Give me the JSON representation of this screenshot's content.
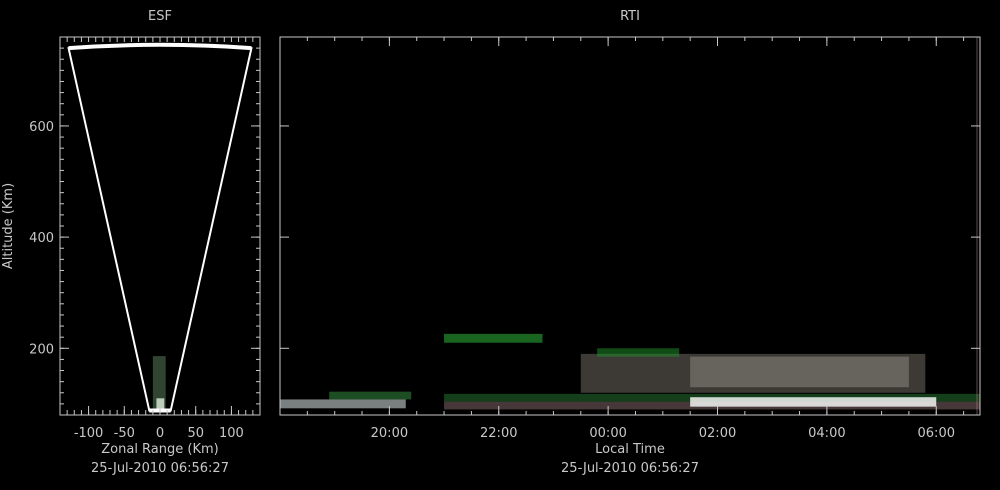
{
  "colors": {
    "background": "#000000",
    "frame": "#c8c8c8",
    "text": "#c8c8c8",
    "fan": "#ffffff",
    "echo_white": "#e8e8e8",
    "echo_green": "#2fb53a",
    "echo_pink": "#c98f8f"
  },
  "chart_data": [
    {
      "type": "esf-fan",
      "title": "ESF",
      "xlabel": "Zonal Range (Km)",
      "ylabel": "Altitude (Km)",
      "timestamp": "25-Jul-2010 06:56:27",
      "xlim": [
        -140,
        140
      ],
      "ylim": [
        80,
        760
      ],
      "xticks": [
        -100,
        -50,
        0,
        50,
        100
      ],
      "xtick_labels": [
        "-100",
        "-50",
        "0",
        "50",
        "100"
      ],
      "yticks": [
        200,
        400,
        600
      ],
      "ytick_labels": [
        "200",
        "400",
        "600"
      ],
      "fan": {
        "apex_altitude": 88,
        "apex_halfwidth": 15,
        "top_altitude": 740,
        "top_halfwidth": 128,
        "arc_peak_altitude": 746
      },
      "echoes": [
        {
          "x0": -10,
          "x1": 8,
          "y0": 88,
          "y1": 186,
          "color": "#5a7a5a",
          "opacity": 0.55
        },
        {
          "x0": -5,
          "x1": 6,
          "y0": 88,
          "y1": 110,
          "color": "#e0f0e0",
          "opacity": 0.8
        }
      ]
    },
    {
      "type": "heatmap",
      "title": "RTI",
      "xlabel": "Local Time",
      "ylabel": "",
      "timestamp": "25-Jul-2010 06:56:27",
      "x_unit": "hours since 18:00",
      "xlim": [
        0,
        12.8
      ],
      "ylim": [
        80,
        760
      ],
      "xticks": [
        2,
        4,
        6,
        8,
        10,
        12
      ],
      "xtick_labels": [
        "20:00",
        "22:00",
        "00:00",
        "02:00",
        "04:00",
        "06:00"
      ],
      "yticks": [
        200,
        400,
        600
      ],
      "echoes": [
        {
          "t0": 0.0,
          "t1": 2.3,
          "y0": 92,
          "y1": 108,
          "color": "#dfe8e8",
          "opacity": 0.55
        },
        {
          "t0": 0.9,
          "t1": 2.4,
          "y0": 108,
          "y1": 122,
          "color": "#3a9a45",
          "opacity": 0.5
        },
        {
          "t0": 3.0,
          "t1": 12.8,
          "y0": 90,
          "y1": 104,
          "color": "#c9a0a0",
          "opacity": 0.35
        },
        {
          "t0": 3.0,
          "t1": 12.8,
          "y0": 104,
          "y1": 118,
          "color": "#2e8a3a",
          "opacity": 0.45
        },
        {
          "t0": 7.5,
          "t1": 12.0,
          "y0": 95,
          "y1": 112,
          "color": "#ffffff",
          "opacity": 0.8
        },
        {
          "t0": 5.5,
          "t1": 11.8,
          "y0": 120,
          "y1": 190,
          "color": "#6f6a60",
          "opacity": 0.55
        },
        {
          "t0": 7.5,
          "t1": 11.5,
          "y0": 130,
          "y1": 185,
          "color": "#b8b2a8",
          "opacity": 0.35
        },
        {
          "t0": 3.0,
          "t1": 4.8,
          "y0": 210,
          "y1": 226,
          "color": "#2aa836",
          "opacity": 0.6
        },
        {
          "t0": 5.8,
          "t1": 7.3,
          "y0": 185,
          "y1": 200,
          "color": "#1f8a2a",
          "opacity": 0.55
        }
      ]
    }
  ]
}
